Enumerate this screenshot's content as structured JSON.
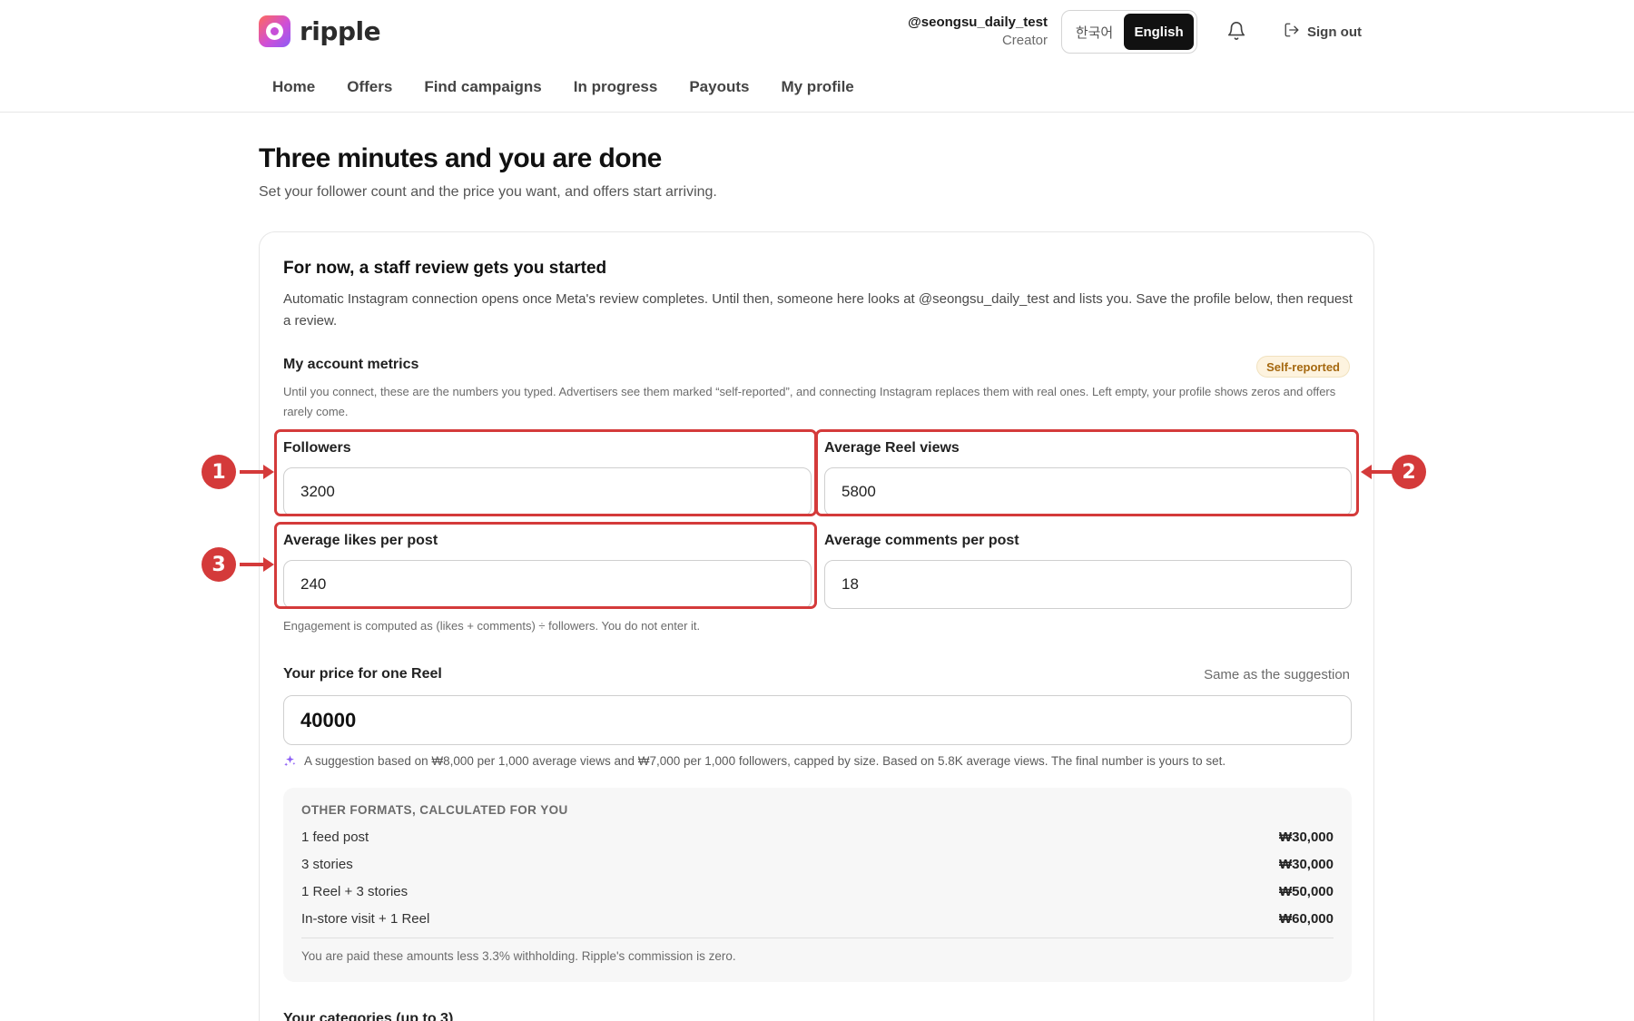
{
  "header": {
    "logo_text": "ripple",
    "user_handle": "@seongsu_daily_test",
    "user_role": "Creator",
    "lang_korean": "한국어",
    "lang_english": "English",
    "sign_out": "Sign out"
  },
  "nav": {
    "items": [
      "Home",
      "Offers",
      "Find campaigns",
      "In progress",
      "Payouts",
      "My profile"
    ]
  },
  "page": {
    "title": "Three minutes and you are done",
    "subtitle": "Set your follower count and the price you want, and offers start arriving."
  },
  "card": {
    "title": "For now, a staff review gets you started",
    "description": "Automatic Instagram connection opens once Meta's review completes. Until then, someone here looks at @seongsu_daily_test and lists you. Save the profile below, then request a review.",
    "metrics_title": "My account metrics",
    "badge": "Self-reported",
    "metrics_description": "Until you connect, these are the numbers you typed. Advertisers see them marked “self-reported”, and connecting Instagram replaces them with real ones. Left empty, your profile shows zeros and offers rarely come.",
    "fields": {
      "followers_label": "Followers",
      "followers_value": "3200",
      "reel_views_label": "Average Reel views",
      "reel_views_value": "5800",
      "likes_label": "Average likes per post",
      "likes_value": "240",
      "comments_label": "Average comments per post",
      "comments_value": "18"
    },
    "engagement_note": "Engagement is computed as (likes + comments) ÷ followers. You do not enter it.",
    "price": {
      "label": "Your price for one Reel",
      "status": "Same as the suggestion",
      "value": "40000",
      "suggestion": "A suggestion based on ₩8,000 per 1,000 average views and ₩7,000 per 1,000 followers, capped by size. Based on 5.8K average views. The final number is yours to set."
    },
    "formats": {
      "heading": "OTHER FORMATS, CALCULATED FOR YOU",
      "rows": [
        {
          "name": "1 feed post",
          "price": "₩30,000"
        },
        {
          "name": "3 stories",
          "price": "₩30,000"
        },
        {
          "name": "1 Reel + 3 stories",
          "price": "₩50,000"
        },
        {
          "name": "In-store visit + 1 Reel",
          "price": "₩60,000"
        }
      ],
      "footnote": "You are paid these amounts less 3.3% withholding. Ripple's commission is zero."
    },
    "categories_title": "Your categories (up to 3)"
  },
  "annotations": {
    "markers": [
      "1",
      "2",
      "3"
    ],
    "color": "#d43a3a"
  },
  "colors": {
    "accent_dark": "#111111",
    "badge_text": "#a5680f",
    "badge_bg": "#fdf3df",
    "highlight": "#d43a3a"
  }
}
